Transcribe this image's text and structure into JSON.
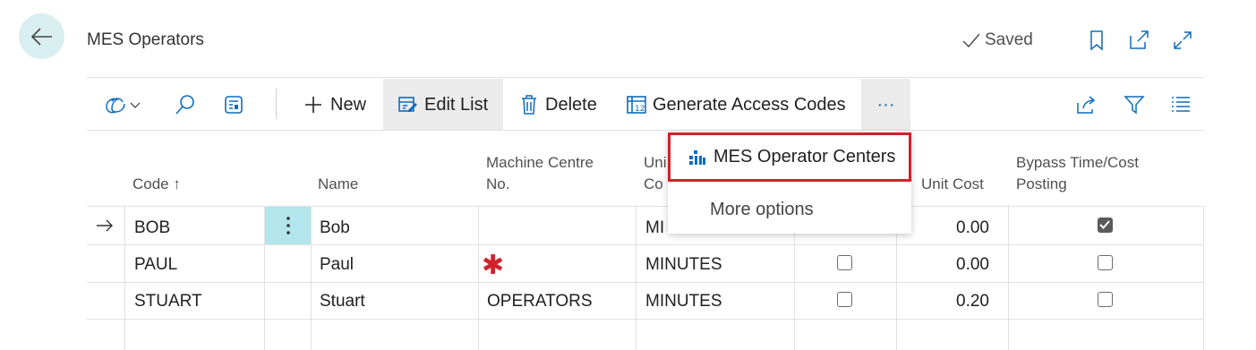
{
  "page": {
    "title": "MES Operators",
    "saved": "Saved"
  },
  "toolbar": {
    "new": "New",
    "edit_list": "Edit List",
    "delete": "Delete",
    "generate_access_codes": "Generate Access Codes",
    "more": "···"
  },
  "columns": {
    "code": "Code",
    "code_sort": "↑",
    "name": "Name",
    "machine_centre_1": "Machine Centre",
    "machine_centre_2": "No.",
    "unit_cost": "Unit Cost",
    "bypass_1": "Bypass Time/Cost",
    "bypass_2": "Posting",
    "uom_partial_1": "Uni",
    "uom_partial_2": "Co"
  },
  "rows": [
    {
      "code": "BOB",
      "name": "Bob",
      "machine_centre": "",
      "uom": "MI",
      "flag": false,
      "unit_cost": "0.00",
      "bypass": true
    },
    {
      "code": "PAUL",
      "name": "Paul",
      "machine_centre": "✱",
      "uom": "MINUTES",
      "flag": false,
      "unit_cost": "0.00",
      "bypass": false
    },
    {
      "code": "STUART",
      "name": "Stuart",
      "machine_centre": "OPERATORS",
      "uom": "MINUTES",
      "flag": false,
      "unit_cost": "0.20",
      "bypass": false
    }
  ],
  "menu": {
    "operator_centers": "MES Operator Centers",
    "more_options": "More options"
  },
  "colors": {
    "accent": "#0f6cbd",
    "back_bg": "#d9eef0",
    "required": "#d4202a",
    "highlight_border": "#d4202a"
  },
  "icons": [
    "back-arrow-icon",
    "bookmark-icon",
    "open-new-icon",
    "expand-icon",
    "copilot-icon",
    "search-icon",
    "filter-pane-icon",
    "plus-icon",
    "edit-list-icon",
    "delete-icon",
    "generate-codes-icon",
    "share-icon",
    "filter-icon",
    "list-icon",
    "row-arrow-icon",
    "row-menu-icon",
    "operator-centers-icon"
  ]
}
